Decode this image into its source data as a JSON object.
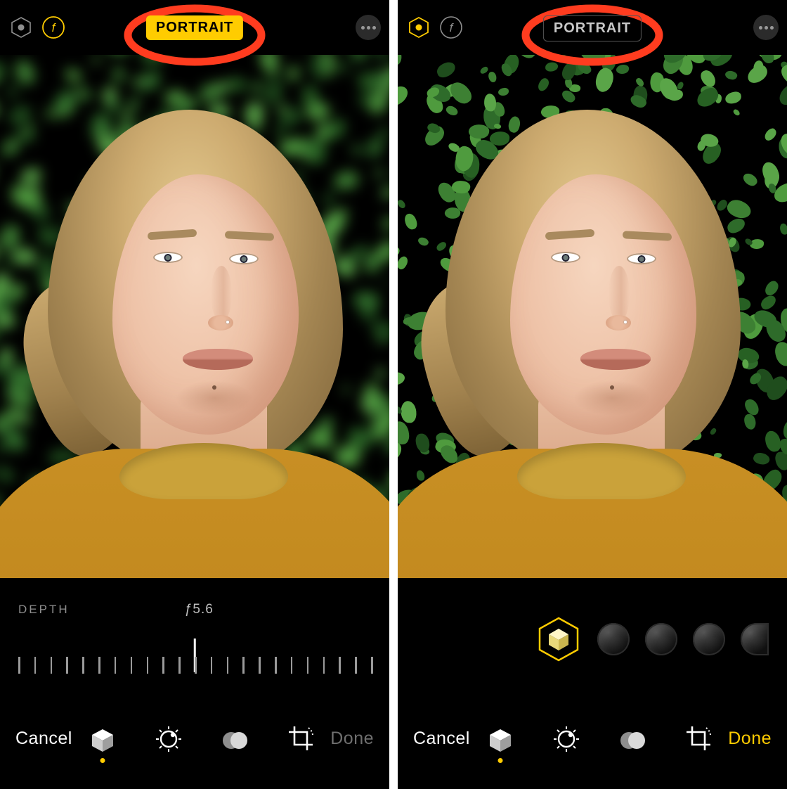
{
  "colors": {
    "accent": "#ffcc00",
    "annotate": "#ff3c1f"
  },
  "panes": {
    "left": {
      "top": {
        "lighting_icon": "lighting-hexagon-icon",
        "lighting_active": false,
        "aperture_icon": "aperture-f-icon",
        "aperture_active": true,
        "mode_label": "PORTRAIT",
        "mode_active": true,
        "more_icon": "more-ellipsis-icon"
      },
      "depth": {
        "label": "DEPTH",
        "value": "ƒ5.6"
      },
      "bottom": {
        "cancel": "Cancel",
        "done": "Done",
        "done_enabled": false,
        "active_tool_index": 0,
        "tools": [
          {
            "name": "portrait-lighting-tool",
            "icon": "cube-icon"
          },
          {
            "name": "adjust-tool",
            "icon": "adjust-dial-icon"
          },
          {
            "name": "filters-tool",
            "icon": "filter-circles-icon"
          },
          {
            "name": "crop-tool",
            "icon": "crop-rotate-icon"
          }
        ]
      }
    },
    "right": {
      "top": {
        "lighting_icon": "lighting-hexagon-icon",
        "lighting_active": true,
        "aperture_icon": "aperture-f-icon",
        "aperture_active": false,
        "mode_label": "PORTRAIT",
        "mode_active": false,
        "more_icon": "more-ellipsis-icon"
      },
      "lighting_options": [
        {
          "name": "natural-light",
          "selected": true
        },
        {
          "name": "studio-light",
          "selected": false
        },
        {
          "name": "contour-light",
          "selected": false
        },
        {
          "name": "stage-light",
          "selected": false
        },
        {
          "name": "stage-light-mono",
          "selected": false
        }
      ],
      "bottom": {
        "cancel": "Cancel",
        "done": "Done",
        "done_enabled": true,
        "active_tool_index": 0,
        "tools": [
          {
            "name": "portrait-lighting-tool",
            "icon": "cube-icon"
          },
          {
            "name": "adjust-tool",
            "icon": "adjust-dial-icon"
          },
          {
            "name": "filters-tool",
            "icon": "filter-circles-icon"
          },
          {
            "name": "crop-tool",
            "icon": "crop-rotate-icon"
          }
        ]
      }
    }
  }
}
